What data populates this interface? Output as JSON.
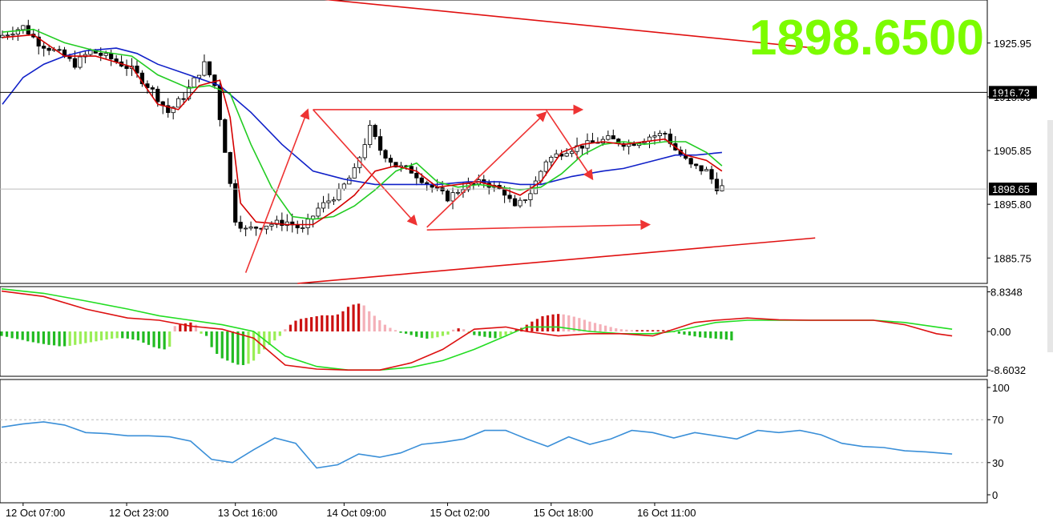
{
  "colors": {
    "background": "#ffffff",
    "bull_candle": "#ffffff",
    "bear_candle": "#000000",
    "ma_fast": "#d40000",
    "ma_mid": "#22cc22",
    "ma_slow": "#1020c8",
    "trendline": "#e01010",
    "annotation_arrow": "#ee3333",
    "price_big": "#7cfc00",
    "macd_hist_pos": "#cc1111",
    "macd_hist_pos_fading": "#f4b0b8",
    "macd_hist_neg": "#22bb22",
    "macd_hist_neg_fading": "#99ee55",
    "macd_signal_fast": "#dd1111",
    "macd_signal_slow": "#22dd22",
    "rsi_line": "#3a8fd8",
    "level_line": "#000000",
    "current_price_line": "#bbbbbb"
  },
  "chart_data": [
    {
      "type": "candlestick",
      "panel": "price",
      "big_price_label": "1898.6500",
      "y_ticks": [
        "1925.95",
        "1915.90",
        "1905.85",
        "1895.80",
        "1885.75"
      ],
      "ylim": [
        1881.0,
        1934.0
      ],
      "highlight_levels": [
        {
          "label": "1916.73",
          "value": 1916.73
        },
        {
          "label": "1898.65",
          "value": 1898.65
        }
      ],
      "x_tick_labels": [
        "12 Oct 07:00",
        "12 Oct 23:00",
        "13 Oct 16:00",
        "14 Oct 09:00",
        "15 Oct 02:00",
        "15 Oct 18:00",
        "16 Oct 11:00"
      ],
      "x_tick_bar_index": [
        4,
        24,
        45,
        66,
        86,
        106,
        126
      ],
      "bar_count": 142,
      "bars_visible": 140,
      "ohlc_anchors": [
        [
          0,
          1927.0
        ],
        [
          5,
          1929.0
        ],
        [
          8,
          1926.0
        ],
        [
          12,
          1924.0
        ],
        [
          15,
          1922.0
        ],
        [
          18,
          1924.5
        ],
        [
          22,
          1923.0
        ],
        [
          26,
          1921.0
        ],
        [
          30,
          1917.0
        ],
        [
          33,
          1913.0
        ],
        [
          36,
          1916.0
        ],
        [
          40,
          1922.0
        ],
        [
          42,
          1918.0
        ],
        [
          44,
          1906.0
        ],
        [
          46,
          1893.0
        ],
        [
          48,
          1891.0
        ],
        [
          52,
          1892.0
        ],
        [
          56,
          1892.5
        ],
        [
          59,
          1891.0
        ],
        [
          62,
          1895.0
        ],
        [
          66,
          1898.0
        ],
        [
          69,
          1902.0
        ],
        [
          72,
          1910.0
        ],
        [
          74,
          1906.0
        ],
        [
          77,
          1903.0
        ],
        [
          80,
          1902.0
        ],
        [
          84,
          1899.0
        ],
        [
          87,
          1897.0
        ],
        [
          90,
          1899.0
        ],
        [
          94,
          1900.0
        ],
        [
          98,
          1898.0
        ],
        [
          100,
          1895.0
        ],
        [
          103,
          1898.0
        ],
        [
          106,
          1904.0
        ],
        [
          110,
          1906.0
        ],
        [
          114,
          1907.0
        ],
        [
          118,
          1908.0
        ],
        [
          122,
          1907.0
        ],
        [
          126,
          1908.5
        ],
        [
          129,
          1909.0
        ],
        [
          131,
          1906.0
        ],
        [
          134,
          1903.0
        ],
        [
          137,
          1902.0
        ],
        [
          139,
          1899.0
        ]
      ],
      "ma_fast": [
        [
          0,
          1927.0
        ],
        [
          6,
          1927.5
        ],
        [
          12,
          1923.5
        ],
        [
          18,
          1923.5
        ],
        [
          25,
          1921.5
        ],
        [
          30,
          1914.5
        ],
        [
          34,
          1913.5
        ],
        [
          38,
          1918.0
        ],
        [
          42,
          1919.0
        ],
        [
          44,
          1912.0
        ],
        [
          46,
          1896.0
        ],
        [
          49,
          1892.5
        ],
        [
          55,
          1892.0
        ],
        [
          60,
          1892.0
        ],
        [
          64,
          1894.5
        ],
        [
          68,
          1897.5
        ],
        [
          72,
          1902.0
        ],
        [
          76,
          1903.0
        ],
        [
          80,
          1902.0
        ],
        [
          84,
          1899.0
        ],
        [
          88,
          1899.5
        ],
        [
          92,
          1900.0
        ],
        [
          96,
          1899.0
        ],
        [
          100,
          1897.5
        ],
        [
          104,
          1900.0
        ],
        [
          108,
          1905.5
        ],
        [
          112,
          1907.0
        ],
        [
          116,
          1907.5
        ],
        [
          120,
          1907.0
        ],
        [
          124,
          1907.5
        ],
        [
          128,
          1908.0
        ],
        [
          132,
          1905.0
        ],
        [
          136,
          1904.0
        ],
        [
          139,
          1902.0
        ]
      ],
      "ma_mid": [
        [
          0,
          1928.0
        ],
        [
          6,
          1928.5
        ],
        [
          12,
          1926.0
        ],
        [
          18,
          1924.5
        ],
        [
          25,
          1923.5
        ],
        [
          30,
          1920.0
        ],
        [
          36,
          1917.5
        ],
        [
          40,
          1918.0
        ],
        [
          44,
          1916.5
        ],
        [
          48,
          1907.0
        ],
        [
          52,
          1899.0
        ],
        [
          56,
          1893.5
        ],
        [
          60,
          1893.0
        ],
        [
          64,
          1893.5
        ],
        [
          68,
          1895.5
        ],
        [
          72,
          1898.5
        ],
        [
          76,
          1902.0
        ],
        [
          80,
          1903.5
        ],
        [
          84,
          1900.0
        ],
        [
          88,
          1899.0
        ],
        [
          92,
          1899.5
        ],
        [
          96,
          1899.0
        ],
        [
          100,
          1898.5
        ],
        [
          104,
          1899.0
        ],
        [
          108,
          1901.5
        ],
        [
          112,
          1905.0
        ],
        [
          116,
          1907.0
        ],
        [
          120,
          1907.5
        ],
        [
          124,
          1907.0
        ],
        [
          128,
          1907.5
        ],
        [
          132,
          1907.5
        ],
        [
          136,
          1905.5
        ],
        [
          139,
          1903.0
        ]
      ],
      "ma_slow": [
        [
          0,
          1914.5
        ],
        [
          4,
          1919.5
        ],
        [
          8,
          1922.0
        ],
        [
          12,
          1923.5
        ],
        [
          16,
          1924.5
        ],
        [
          22,
          1925.0
        ],
        [
          26,
          1924.0
        ],
        [
          30,
          1922.0
        ],
        [
          36,
          1920.0
        ],
        [
          42,
          1918.0
        ],
        [
          48,
          1913.0
        ],
        [
          54,
          1907.0
        ],
        [
          60,
          1902.0
        ],
        [
          66,
          1900.5
        ],
        [
          72,
          1899.5
        ],
        [
          78,
          1899.5
        ],
        [
          84,
          1899.5
        ],
        [
          90,
          1900.0
        ],
        [
          96,
          1900.0
        ],
        [
          100,
          1899.5
        ],
        [
          104,
          1899.5
        ],
        [
          110,
          1901.0
        ],
        [
          116,
          1902.0
        ],
        [
          120,
          1902.5
        ],
        [
          126,
          1904.0
        ],
        [
          130,
          1905.0
        ],
        [
          134,
          1905.0
        ],
        [
          139,
          1905.5
        ]
      ],
      "trendlines": [
        {
          "from": [
            27,
            1937.5
          ],
          "to": [
            157,
            1925.0
          ]
        },
        {
          "from": [
            57,
            1881.0
          ],
          "to": [
            157,
            1889.5
          ]
        }
      ],
      "arrows": [
        {
          "from": [
            47,
            1883.0
          ],
          "to": [
            59,
            1913.5
          ]
        },
        {
          "from": [
            60,
            1913.5
          ],
          "to": [
            112,
            1913.5
          ]
        },
        {
          "from": [
            60,
            1913.5
          ],
          "to": [
            80,
            1892.0
          ]
        },
        {
          "from": [
            82,
            1891.0
          ],
          "to": [
            125,
            1892.0
          ]
        },
        {
          "from": [
            82,
            1891.5
          ],
          "to": [
            105,
            1913.0
          ]
        },
        {
          "from": [
            105,
            1913.5
          ],
          "to": [
            114,
            1900.5
          ]
        }
      ]
    },
    {
      "type": "macd",
      "panel": "macd",
      "y_ticks": [
        "8.8348",
        "0.00",
        "-8.6032"
      ],
      "ylim": [
        -10.0,
        10.0
      ],
      "histogram": [
        -1.0,
        -1.2,
        -1.5,
        -1.7,
        -1.9,
        -2.2,
        -2.4,
        -2.6,
        -2.8,
        -3.0,
        -3.1,
        -3.3,
        -3.3,
        -3.2,
        -3.0,
        -2.8,
        -2.6,
        -2.4,
        -2.2,
        -2.0,
        -1.8,
        -1.6,
        -1.5,
        -1.5,
        -1.6,
        -1.8,
        -2.0,
        -2.5,
        -3.0,
        -3.5,
        -3.8,
        -4.0,
        -3.4,
        1.2,
        1.5,
        1.8,
        2.0,
        1.5,
        -0.5,
        -1.0,
        -3.5,
        -5.0,
        -6.0,
        -6.5,
        -7.0,
        -7.4,
        -7.5,
        -7.2,
        -6.5,
        -5.0,
        -4.0,
        -3.0,
        -2.0,
        -1.0,
        0.5,
        1.5,
        2.4,
        2.8,
        3.0,
        3.2,
        3.4,
        3.6,
        3.6,
        3.6,
        3.8,
        4.5,
        5.5,
        6.0,
        6.2,
        5.8,
        4.5,
        3.5,
        2.5,
        1.5,
        0.8,
        0.3,
        -0.3,
        -0.5,
        -0.8,
        -1.2,
        -1.4,
        -1.6,
        -1.5,
        -1.3,
        -1.0,
        -0.7,
        0.4,
        0.7,
        0.5,
        -0.4,
        -0.8,
        -1.0,
        -1.2,
        -1.4,
        -1.5,
        -1.3,
        -0.8,
        -0.3,
        0.4,
        0.8,
        1.5,
        2.2,
        2.8,
        3.4,
        3.6,
        3.8,
        3.9,
        3.8,
        3.6,
        3.3,
        3.0,
        2.6,
        2.2,
        1.9,
        1.6,
        1.3,
        1.0,
        0.7,
        0.5,
        0.4,
        0.3,
        0.3,
        0.3,
        0.3,
        0.3,
        0.3,
        0.3,
        0.3,
        -0.2,
        -0.5,
        -0.7,
        -0.9,
        -1.1,
        -1.3,
        -1.4,
        -1.5,
        -1.6,
        -1.7,
        -1.8,
        -2.0
      ],
      "line_fast": [
        [
          0,
          9.0
        ],
        [
          8,
          7.8
        ],
        [
          16,
          5.0
        ],
        [
          24,
          3.0
        ],
        [
          30,
          2.5
        ],
        [
          36,
          1.2
        ],
        [
          42,
          0.5
        ],
        [
          48,
          -1.5
        ],
        [
          54,
          -7.5
        ],
        [
          60,
          -8.4
        ],
        [
          66,
          -8.6
        ],
        [
          72,
          -8.6
        ],
        [
          78,
          -7.0
        ],
        [
          84,
          -4.0
        ],
        [
          90,
          0.5
        ],
        [
          96,
          1.0
        ],
        [
          100,
          0.0
        ],
        [
          106,
          -1.0
        ],
        [
          112,
          -0.5
        ],
        [
          118,
          -0.5
        ],
        [
          124,
          -1.0
        ],
        [
          128,
          0.5
        ],
        [
          132,
          2.0
        ],
        [
          136,
          2.5
        ],
        [
          142,
          3.0
        ],
        [
          148,
          2.6
        ],
        [
          154,
          2.5
        ],
        [
          160,
          2.5
        ],
        [
          166,
          2.5
        ],
        [
          172,
          1.5
        ],
        [
          178,
          -0.5
        ],
        [
          181,
          -1.0
        ]
      ],
      "line_slow": [
        [
          0,
          9.5
        ],
        [
          8,
          8.5
        ],
        [
          16,
          6.8
        ],
        [
          24,
          5.0
        ],
        [
          30,
          3.5
        ],
        [
          36,
          2.5
        ],
        [
          42,
          1.5
        ],
        [
          48,
          0.0
        ],
        [
          54,
          -5.5
        ],
        [
          60,
          -7.8
        ],
        [
          66,
          -8.6
        ],
        [
          72,
          -8.6
        ],
        [
          78,
          -8.0
        ],
        [
          84,
          -6.5
        ],
        [
          90,
          -4.0
        ],
        [
          96,
          -1.0
        ],
        [
          100,
          1.0
        ],
        [
          106,
          1.0
        ],
        [
          112,
          0.0
        ],
        [
          118,
          -0.5
        ],
        [
          124,
          -0.5
        ],
        [
          128,
          0.0
        ],
        [
          132,
          1.0
        ],
        [
          136,
          2.0
        ],
        [
          142,
          2.5
        ],
        [
          148,
          2.5
        ],
        [
          154,
          2.5
        ],
        [
          160,
          2.5
        ],
        [
          166,
          2.5
        ],
        [
          172,
          2.0
        ],
        [
          178,
          1.0
        ],
        [
          181,
          0.5
        ]
      ]
    },
    {
      "type": "line",
      "panel": "rsi",
      "y_ticks": [
        "100",
        "70",
        "30",
        "0"
      ],
      "ylim": [
        0,
        100
      ],
      "levels": [
        70,
        30
      ],
      "values": [
        [
          0,
          63
        ],
        [
          4,
          66
        ],
        [
          8,
          68
        ],
        [
          12,
          65
        ],
        [
          16,
          58
        ],
        [
          20,
          57
        ],
        [
          24,
          55
        ],
        [
          28,
          55
        ],
        [
          32,
          54
        ],
        [
          36,
          50
        ],
        [
          40,
          33
        ],
        [
          44,
          30
        ],
        [
          48,
          42
        ],
        [
          52,
          53
        ],
        [
          56,
          48
        ],
        [
          60,
          25
        ],
        [
          64,
          28
        ],
        [
          68,
          38
        ],
        [
          72,
          35
        ],
        [
          76,
          39
        ],
        [
          80,
          47
        ],
        [
          84,
          49
        ],
        [
          88,
          52
        ],
        [
          92,
          60
        ],
        [
          96,
          60
        ],
        [
          100,
          52
        ],
        [
          104,
          45
        ],
        [
          108,
          54
        ],
        [
          112,
          47
        ],
        [
          116,
          52
        ],
        [
          120,
          60
        ],
        [
          124,
          58
        ],
        [
          128,
          53
        ],
        [
          132,
          58
        ],
        [
          136,
          55
        ],
        [
          140,
          52
        ],
        [
          144,
          60
        ],
        [
          148,
          58
        ],
        [
          152,
          60
        ],
        [
          156,
          56
        ],
        [
          160,
          48
        ],
        [
          164,
          45
        ],
        [
          168,
          44
        ],
        [
          172,
          41
        ],
        [
          176,
          40
        ],
        [
          181,
          38
        ]
      ]
    }
  ]
}
